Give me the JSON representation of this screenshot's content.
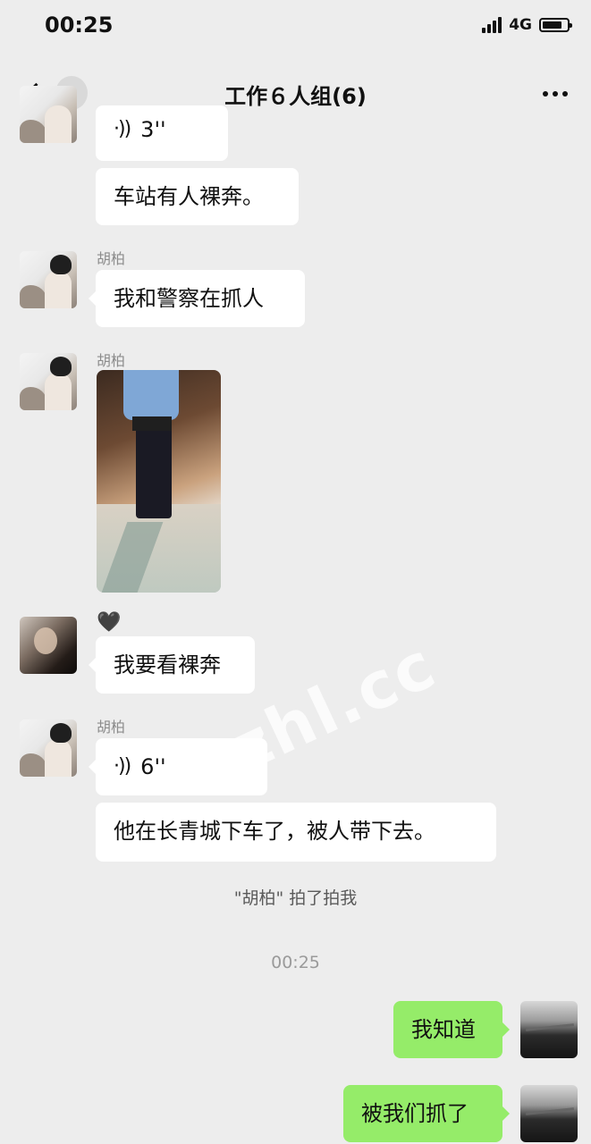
{
  "status_bar": {
    "time": "00:25",
    "network": "4G",
    "battery_level": 0.8
  },
  "nav": {
    "back_badge": "1",
    "title": "工作６人组(6)"
  },
  "messages": {
    "m1_voice": {
      "duration": "3''"
    },
    "m2": {
      "text": "车站有人裸奔。"
    },
    "m3": {
      "sender": "胡柏",
      "text": "我和警察在抓人"
    },
    "m4": {
      "sender": "胡柏"
    },
    "m5": {
      "sender_symbol": "🖤",
      "text": "我要看裸奔"
    },
    "m6": {
      "sender": "胡柏",
      "voice_duration": "6''"
    },
    "m7": {
      "text": "他在长青城下车了，被人带下去。"
    },
    "system_pat": "\"胡柏\" 拍了拍我",
    "timestamp": "00:25",
    "me1": {
      "text": "我知道"
    },
    "me2": {
      "text": "被我们抓了"
    }
  },
  "watermark": "bzhl.cc",
  "icons": {
    "back": "chevron-left-icon",
    "more": "more-dots-icon",
    "voice": "voice-wave-icon"
  }
}
